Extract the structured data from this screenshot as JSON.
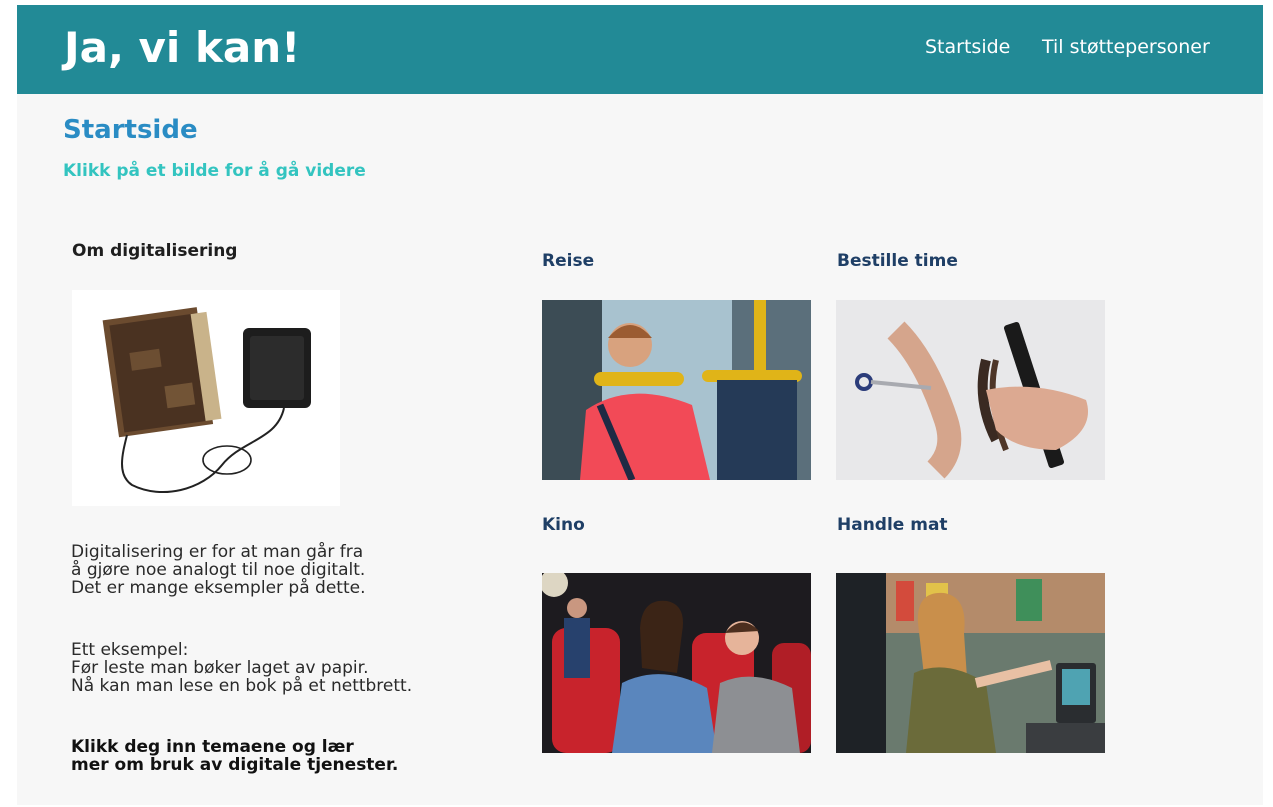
{
  "header": {
    "brand": "Ja, vi kan!",
    "nav": [
      "Startside",
      "Til støttepersoner"
    ]
  },
  "main": {
    "title": "Startside",
    "subtitle": "Klikk på et bilde for å gå videre"
  },
  "intro": {
    "heading": "Om digitalisering",
    "paragraph1": [
      "Digitalisering er for at man går fra",
      "å gjøre noe analogt til noe digitalt.",
      "Det er mange eksempler på dette."
    ],
    "paragraph2": [
      "Ett eksempel:",
      "Før leste man bøker laget av papir.",
      "Nå kan man lese en bok på et nettbrett."
    ],
    "paragraph3": [
      "Klikk deg inn temaene og lær",
      "mer om bruk av digitale tjenester."
    ]
  },
  "tiles": [
    {
      "label": "Reise"
    },
    {
      "label": "Bestille time"
    },
    {
      "label": "Kino"
    },
    {
      "label": "Handle mat"
    }
  ],
  "colors": {
    "header_bg": "#228a96",
    "title": "#2a8cc4",
    "subtitle": "#33c4c0",
    "tile_title": "#1f3f66"
  }
}
